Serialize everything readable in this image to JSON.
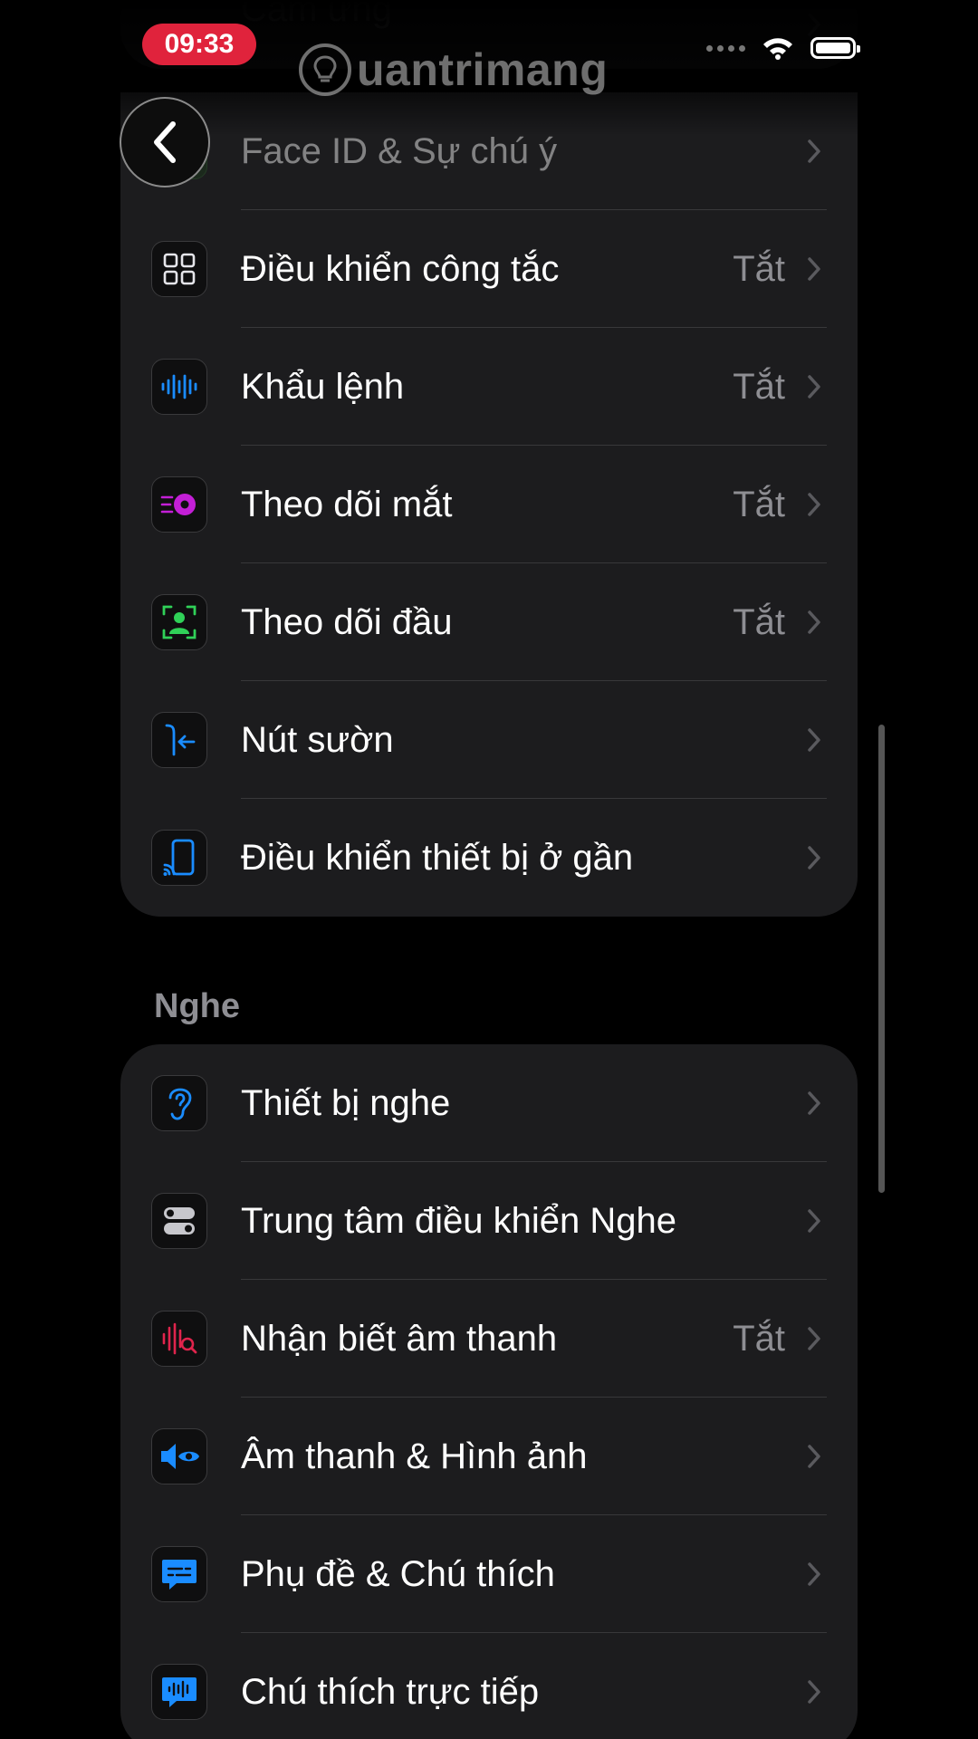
{
  "status": {
    "time": "09:33"
  },
  "watermark": "uantrimang",
  "partial_top_label": "Cảm ứng",
  "group_interaction": [
    {
      "label": "Face ID & Sự chú ý",
      "value": "",
      "icon": "face-id-icon",
      "dim": true
    },
    {
      "label": "Điều khiển công tắc",
      "value": "Tắt",
      "icon": "switch-control-icon"
    },
    {
      "label": "Khẩu lệnh",
      "value": "Tắt",
      "icon": "voice-control-icon"
    },
    {
      "label": "Theo dõi mắt",
      "value": "Tắt",
      "icon": "eye-tracking-icon"
    },
    {
      "label": "Theo dõi đầu",
      "value": "Tắt",
      "icon": "head-tracking-icon"
    },
    {
      "label": "Nút sườn",
      "value": "",
      "icon": "side-button-icon"
    },
    {
      "label": "Điều khiển thiết bị ở gần",
      "value": "",
      "icon": "nearby-device-icon"
    }
  ],
  "hearing": {
    "header": "Nghe",
    "items": [
      {
        "label": "Thiết bị nghe",
        "value": "",
        "icon": "ear-icon"
      },
      {
        "label": "Trung tâm điều khiển Nghe",
        "value": "",
        "icon": "toggle-icon"
      },
      {
        "label": "Nhận biết âm thanh",
        "value": "Tắt",
        "icon": "sound-recognition-icon"
      },
      {
        "label": "Âm thanh & Hình ảnh",
        "value": "",
        "icon": "audio-visual-icon"
      },
      {
        "label": "Phụ đề & Chú thích",
        "value": "",
        "icon": "subtitles-icon"
      },
      {
        "label": "Chú thích trực tiếp",
        "value": "",
        "icon": "live-captions-icon"
      }
    ]
  },
  "colors": {
    "accent_blue": "#1a8cff",
    "eye_purple": "#c31fd6",
    "head_green": "#30d158",
    "sound_red": "#e0244c"
  }
}
